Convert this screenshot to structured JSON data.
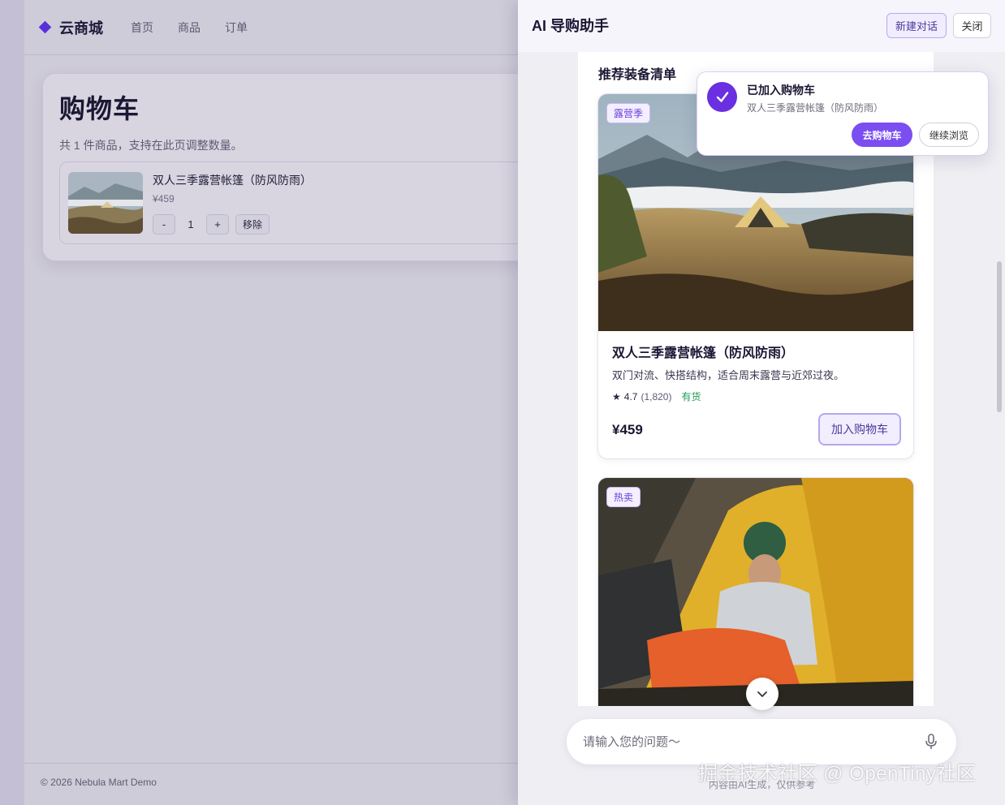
{
  "app": {
    "brand": "云商城",
    "nav": [
      "首页",
      "商品",
      "订单"
    ],
    "footer": "© 2026 Nebula Mart Demo"
  },
  "cart": {
    "title": "购物车",
    "subtitle": "共 1 件商品，支持在此页调整数量。",
    "item": {
      "name": "双人三季露营帐篷（防风防雨）",
      "price": "¥459",
      "qty_minus": "-",
      "quantity": "1",
      "qty_plus": "+",
      "remove": "移除"
    }
  },
  "assistant": {
    "title": "AI 导购助手",
    "new_chat": "新建对话",
    "close": "关闭",
    "section_title": "推荐装备清单",
    "products": [
      {
        "badge": "露营季",
        "name": "双人三季露营帐篷（防风防雨）",
        "desc": "双门对流、快搭结构，适合周末露营与近郊过夜。",
        "rating": "4.7",
        "reviews": "(1,820)",
        "stock": "有货",
        "price": "¥459",
        "add": "加入购物车"
      },
      {
        "badge": "热卖"
      }
    ],
    "input_placeholder": "请输入您的问题～",
    "disclaimer": "内容由AI生成，仅供参考",
    "watermark": "掘金技术社区 @ OpenTiny社区"
  },
  "toast": {
    "title": "已加入购物车",
    "subtitle": "双人三季露营帐篷（防风防雨）",
    "go_cart": "去购物车",
    "continue": "继续浏览"
  },
  "colors": {
    "accent": "#7a4ef0",
    "brand": "#5a2fd6",
    "in_stock": "#1f9d55"
  }
}
